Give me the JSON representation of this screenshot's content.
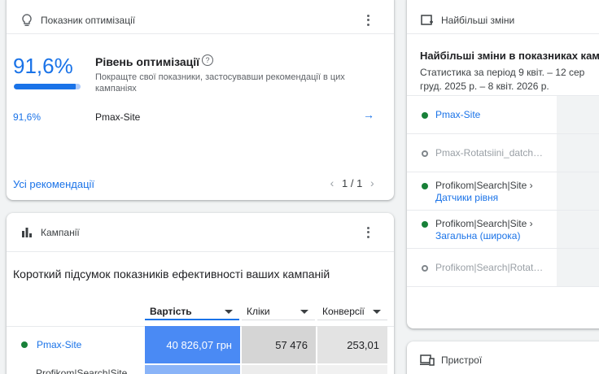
{
  "optimization": {
    "header": "Показник оптимізації",
    "score": "91,6%",
    "score_fraction": 0.916,
    "title": "Рівень оптимізації",
    "help": "?",
    "description": "Покращте свої показники, застосувавши рекомендації в цих кампаніях",
    "rows": [
      {
        "score": "91,6%",
        "name": "Pmax-Site",
        "arrow": "→"
      }
    ],
    "all_recommendations": "Усі рекомендації",
    "pager": "1 / 1"
  },
  "campaigns": {
    "header": "Кампанії",
    "title": "Короткий підсумок показників ефективності ваших кампаній",
    "columns": [
      {
        "label": "Вартість"
      },
      {
        "label": "Кліки"
      },
      {
        "label": "Конверсії"
      }
    ],
    "rows": [
      {
        "name": "Pmax-Site",
        "cost": "40 826,07 грн",
        "clicks": "57 476",
        "conversions": "253,01"
      },
      {
        "name": "Profikom|Search|Site"
      }
    ]
  },
  "changes": {
    "header": "Найбільші зміни",
    "title": "Найбільші зміни в показниках кам",
    "subtitle_line1": "Статистика за період 9 квіт. – 12 сер",
    "subtitle_line2": "груд. 2025 р. – 8 квіт. 2026 р.",
    "items": [
      {
        "line1": "Pmax-Site",
        "line2": "",
        "status": "enabled"
      },
      {
        "line1": "Pmax-Rotatsiini_datch…",
        "line2": "",
        "status": "paused"
      },
      {
        "line1": "Profikom|Search|Site ›",
        "line2": "Датчики рівня",
        "status": "enabled"
      },
      {
        "line1": "Profikom|Search|Site ›",
        "line2": "Загальна (широка)",
        "status": "enabled"
      },
      {
        "line1": "Profikom|Search|Rotat…",
        "line2": "",
        "status": "paused"
      }
    ]
  },
  "devices": {
    "header": "Пристрої"
  },
  "colors": {
    "accent": "#1a73e8",
    "enabled": "#188038",
    "highlight_cell": "#4a8af4",
    "gray_cell": "#d5d5d5"
  }
}
